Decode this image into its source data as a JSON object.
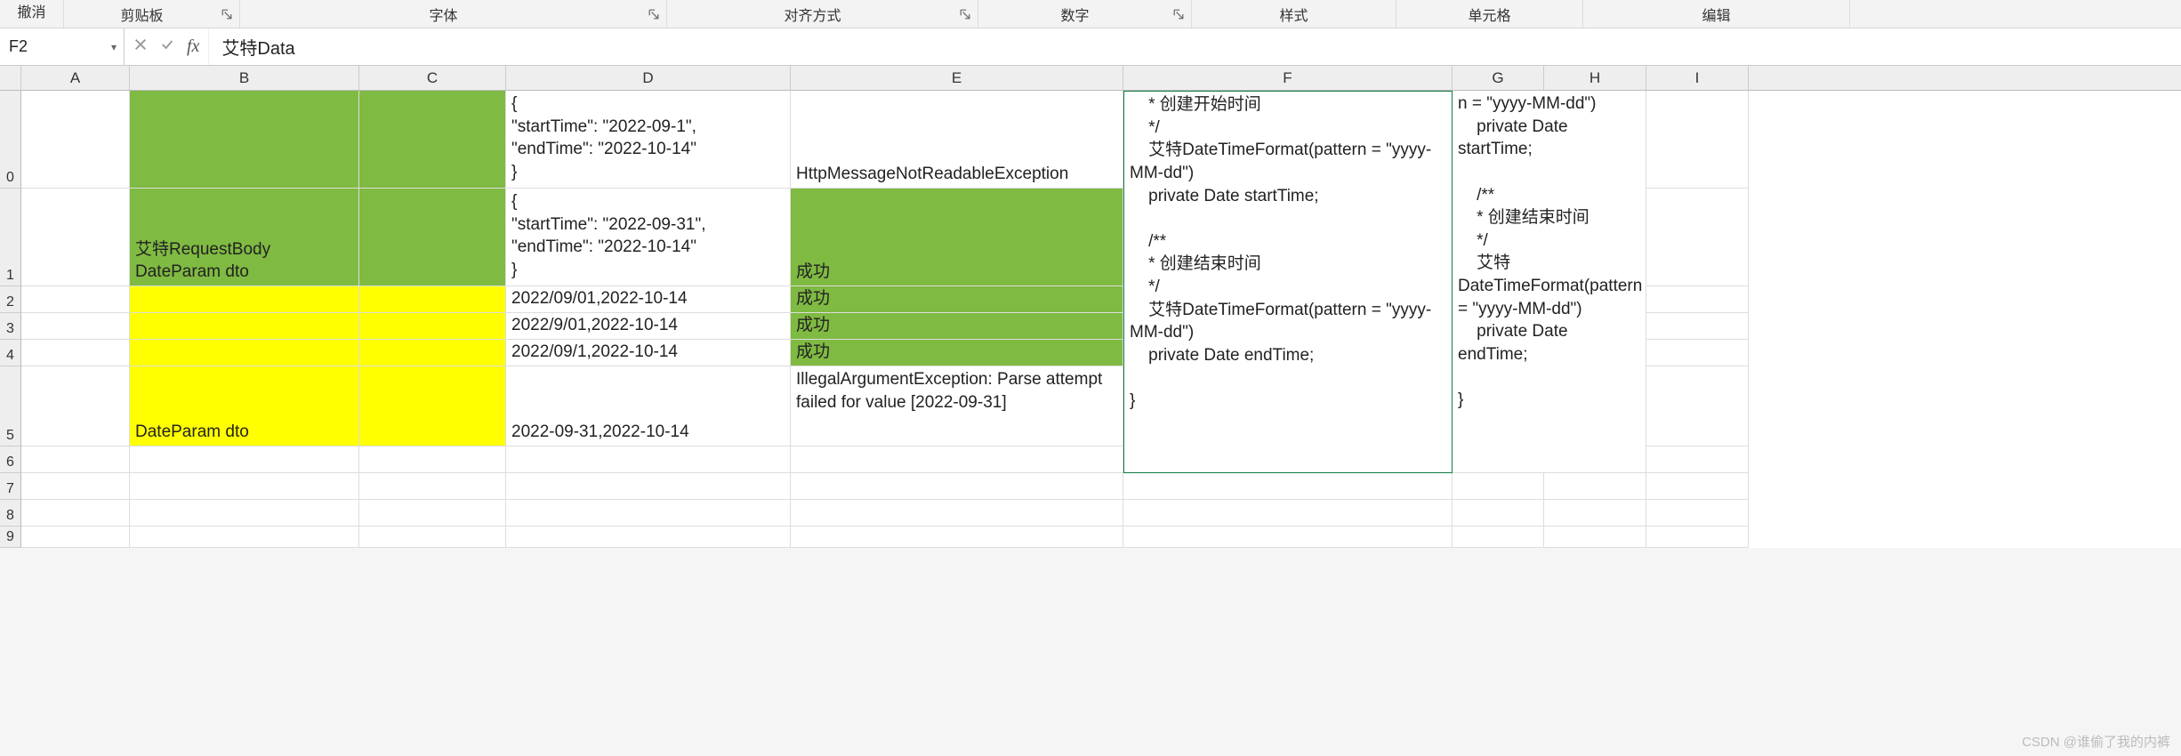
{
  "ribbon": {
    "undo": "撤消",
    "groups": {
      "clipboard": "剪贴板",
      "font": "字体",
      "alignment": "对齐方式",
      "number": "数字",
      "styles": "样式",
      "cells": "单元格",
      "editing": "编辑"
    }
  },
  "formula_bar": {
    "name_box": "F2",
    "formula": "艾特Data"
  },
  "columns": [
    "A",
    "B",
    "C",
    "D",
    "E",
    "F",
    "G",
    "H",
    "I"
  ],
  "row_headers": [
    "0",
    "1",
    "2",
    "3",
    "4",
    "5",
    "6",
    "7",
    "8",
    "9"
  ],
  "cells": {
    "B1": "艾特RequestBody DateParam dto",
    "D0": "{\n\"startTime\": \"2022-09-1\",\n\"endTime\": \"2022-10-14\"\n}",
    "D1": "{\n\"startTime\": \"2022-09-31\",\n\"endTime\": \"2022-10-14\"\n}",
    "E0": "HttpMessageNotReadableException",
    "E1": "成功",
    "D2": "2022/09/01,2022-10-14",
    "E2": "成功",
    "D3": "2022/9/01,2022-10-14",
    "E3": "成功",
    "D4": "2022/09/1,2022-10-14",
    "E4": "成功",
    "B5": "DateParam dto",
    "D5": "2022-09-31,2022-10-14",
    "E5": "IllegalArgumentException: Parse attempt failed for value [2022-09-31]",
    "F_block": "    * 创建开始时间\n    */\n    艾特DateTimeFormat(pattern = \"yyyy-MM-dd\")\n    private Date startTime;\n\n    /**\n    * 创建结束时间\n    */\n    艾特DateTimeFormat(pattern = \"yyyy-MM-dd\")\n    private Date endTime;\n\n}",
    "G_block": "n = \"yyyy-MM-dd\")\n    private Date startTime;\n\n    /**\n    * 创建结束时间\n    */\n    艾特DateTimeFormat(pattern = \"yyyy-MM-dd\")\n    private Date endTime;\n\n}"
  },
  "colors": {
    "green": "#7fba42",
    "yellow": "#ffff00",
    "selection": "#107c41"
  },
  "watermark": "CSDN @谁偷了我的内裤"
}
